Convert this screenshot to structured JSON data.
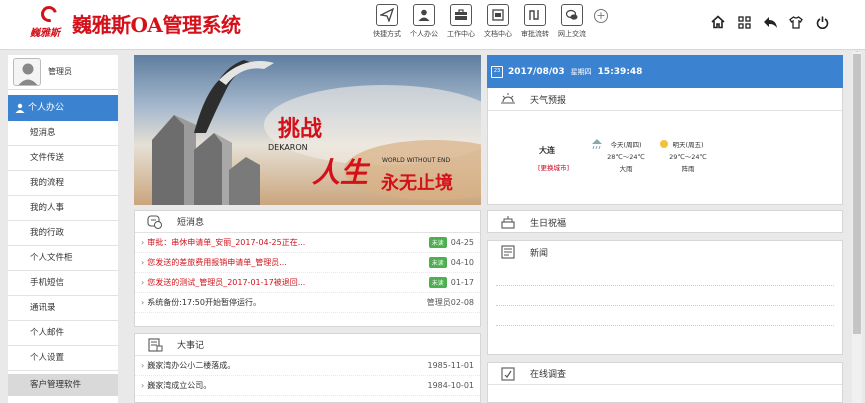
{
  "app": {
    "brand_small": "巍雅斯",
    "title": "巍雅斯OA管理系统"
  },
  "toolbar": [
    {
      "label": "快捷方式",
      "icon": "send-icon"
    },
    {
      "label": "个人办公",
      "icon": "person-icon"
    },
    {
      "label": "工作中心",
      "icon": "briefcase-icon"
    },
    {
      "label": "文档中心",
      "icon": "document-icon"
    },
    {
      "label": "审批流转",
      "icon": "workflow-icon"
    },
    {
      "label": "网上交流",
      "icon": "chat-icon"
    }
  ],
  "header_icons": [
    "home-icon",
    "grid-icon",
    "back-icon",
    "skin-icon",
    "power-icon"
  ],
  "user": {
    "name": "管理员"
  },
  "sidebar": {
    "section": "个人办公",
    "items": [
      "短消息",
      "文件传送",
      "我的流程",
      "我的人事",
      "我的行政",
      "个人文件柜",
      "手机短信",
      "通讯录",
      "个人邮件",
      "个人设置"
    ],
    "footer": "客户管理软件"
  },
  "banner": {
    "line1": "挑战",
    "line2": "DEKARON",
    "line3": "人生",
    "line4": "WORLD WITHOUT END",
    "line5": "永无止境"
  },
  "messages": {
    "title": "短消息",
    "items": [
      {
        "text": "审批：串休申请单_安丽_2017-04-25正在...",
        "tag": "未读",
        "date": "04-25",
        "red": true
      },
      {
        "text": "您发送的差旅费用报销申请单_管理员...",
        "tag": "未读",
        "date": "04-10",
        "red": true
      },
      {
        "text": "您发送的测试_管理员_2017-01-17被退回...",
        "tag": "未读",
        "date": "01-17",
        "red": true
      },
      {
        "text": "系统备份:17:50开始暂停运行。",
        "tag": "",
        "date": "管理员02-08",
        "red": false
      }
    ]
  },
  "events": {
    "title": "大事记",
    "items": [
      {
        "text": "巍家湾办公小二楼落成。",
        "date": "1985-11-01"
      },
      {
        "text": "巍家湾成立公司。",
        "date": "1984-10-01"
      }
    ]
  },
  "datebar": {
    "date": "2017/08/03",
    "weekday": "星期四",
    "time": "15:39:48",
    "cal_day": "23"
  },
  "weather": {
    "title": "天气预报",
    "city": "大连",
    "change": "[更换城市]",
    "today": {
      "label": "今天(周四)",
      "temp": "28℃～24℃",
      "desc": "大雨"
    },
    "tomorrow": {
      "label": "明天(周五)",
      "temp": "29℃～24℃",
      "desc": "阵雨"
    }
  },
  "birthday": {
    "title": "生日祝福"
  },
  "news": {
    "title": "新闻"
  },
  "survey": {
    "title": "在线调查"
  },
  "colors": {
    "accent": "#3b83d0",
    "brand": "#d4101a",
    "unread_tag": "#4caf50",
    "alert_text": "#d0131b"
  }
}
